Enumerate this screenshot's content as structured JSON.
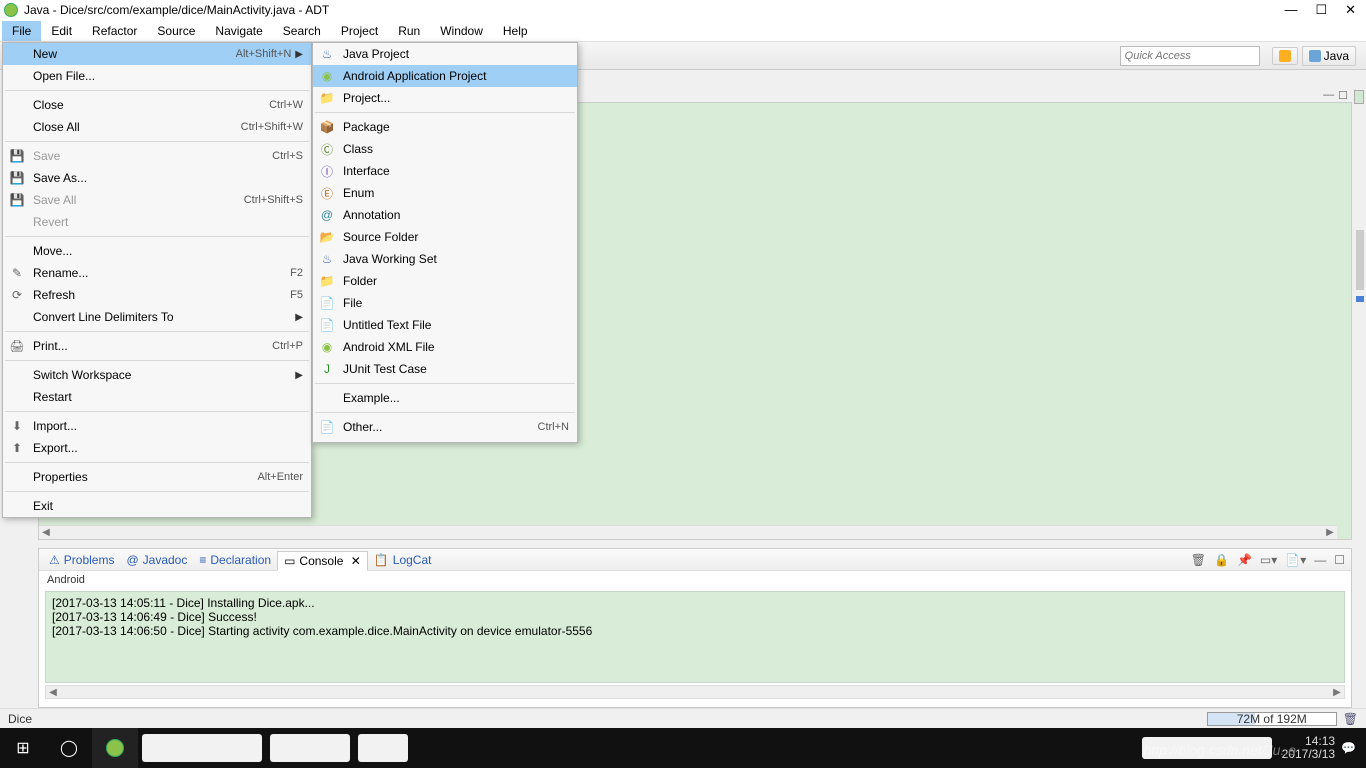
{
  "window": {
    "title": "Java - Dice/src/com/example/dice/MainActivity.java - ADT"
  },
  "menubar": [
    "File",
    "Edit",
    "Refactor",
    "Source",
    "Navigate",
    "Search",
    "Project",
    "Run",
    "Window",
    "Help"
  ],
  "quick_access_placeholder": "Quick Access",
  "perspective_label": "Java",
  "file_menu": {
    "new": {
      "label": "New",
      "shortcut": "Alt+Shift+N"
    },
    "open_file": {
      "label": "Open File..."
    },
    "close": {
      "label": "Close",
      "shortcut": "Ctrl+W"
    },
    "close_all": {
      "label": "Close All",
      "shortcut": "Ctrl+Shift+W"
    },
    "save": {
      "label": "Save",
      "shortcut": "Ctrl+S"
    },
    "save_as": {
      "label": "Save As..."
    },
    "save_all": {
      "label": "Save All",
      "shortcut": "Ctrl+Shift+S"
    },
    "revert": {
      "label": "Revert"
    },
    "move": {
      "label": "Move..."
    },
    "rename": {
      "label": "Rename...",
      "shortcut": "F2"
    },
    "refresh": {
      "label": "Refresh",
      "shortcut": "F5"
    },
    "convert": {
      "label": "Convert Line Delimiters To"
    },
    "print": {
      "label": "Print...",
      "shortcut": "Ctrl+P"
    },
    "switch_ws": {
      "label": "Switch Workspace"
    },
    "restart": {
      "label": "Restart"
    },
    "import": {
      "label": "Import..."
    },
    "export": {
      "label": "Export..."
    },
    "properties": {
      "label": "Properties",
      "shortcut": "Alt+Enter"
    },
    "exit": {
      "label": "Exit"
    }
  },
  "new_menu": {
    "java_project": "Java Project",
    "android_project": "Android Application Project",
    "project": "Project...",
    "package": "Package",
    "class": "Class",
    "interface": "Interface",
    "enum": "Enum",
    "annotation": "Annotation",
    "source_folder": "Source Folder",
    "working_set": "Java Working Set",
    "folder": "Folder",
    "file": "File",
    "untitled": "Untitled Text File",
    "android_xml": "Android XML File",
    "junit": "JUnit Test Case",
    "example": "Example...",
    "other": {
      "label": "Other...",
      "shortcut": "Ctrl+N"
    }
  },
  "bottom_tabs": {
    "problems": "Problems",
    "javadoc": "Javadoc",
    "declaration": "Declaration",
    "console": "Console",
    "logcat": "LogCat"
  },
  "console": {
    "title": "Android",
    "lines": [
      "[2017-03-13 14:05:11 - Dice] Installing Dice.apk...",
      "[2017-03-13 14:06:49 - Dice] Success!",
      "[2017-03-13 14:06:50 - Dice] Starting activity com.example.dice.MainActivity on device emulator-5556"
    ]
  },
  "statusbar": {
    "left": "Dice",
    "memory": "72M of 192M"
  },
  "taskbar": {
    "time": "14:13",
    "date": "2017/3/13",
    "watermark": "http://blog.csdn.net/Ju..e"
  }
}
